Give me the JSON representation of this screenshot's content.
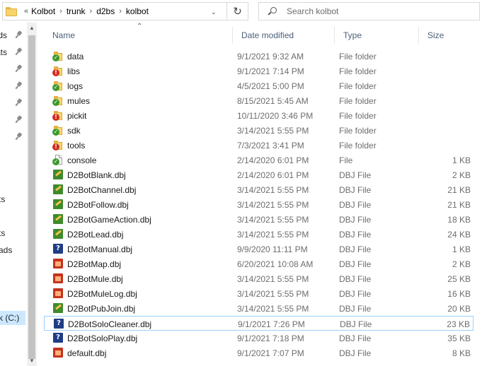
{
  "address": {
    "overflow": "«",
    "crumbs": [
      "Kolbot",
      "trunk",
      "d2bs",
      "kolbot"
    ]
  },
  "search": {
    "placeholder": "Search kolbot"
  },
  "nav": {
    "items": [
      {
        "label": "ds",
        "pinned": true
      },
      {
        "label": "ats",
        "pinned": true
      },
      {
        "label": "",
        "pinned": true
      },
      {
        "label": "",
        "pinned": true
      },
      {
        "label": "",
        "pinned": true
      },
      {
        "label": "",
        "pinned": true
      },
      {
        "label": "",
        "pinned": true
      },
      {
        "label": "ts",
        "pinned": false
      },
      {
        "label": "ts",
        "pinned": false
      },
      {
        "label": "ads",
        "pinned": false
      },
      {
        "label": "k (C:)",
        "pinned": false,
        "selected": true
      }
    ]
  },
  "columns": {
    "name": "Name",
    "date": "Date modified",
    "type": "Type",
    "size": "Size"
  },
  "files": [
    {
      "name": "data",
      "date": "9/1/2021 9:32 AM",
      "type": "File folder",
      "size": "",
      "icon": "folder-synced"
    },
    {
      "name": "libs",
      "date": "9/1/2021 7:14 PM",
      "type": "File folder",
      "size": "",
      "icon": "folder-conflict"
    },
    {
      "name": "logs",
      "date": "4/5/2021 5:00 PM",
      "type": "File folder",
      "size": "",
      "icon": "folder-synced"
    },
    {
      "name": "mules",
      "date": "8/15/2021 5:45 AM",
      "type": "File folder",
      "size": "",
      "icon": "folder-synced"
    },
    {
      "name": "pickit",
      "date": "10/11/2020 3:46 PM",
      "type": "File folder",
      "size": "",
      "icon": "folder-conflict"
    },
    {
      "name": "sdk",
      "date": "3/14/2021 5:55 PM",
      "type": "File folder",
      "size": "",
      "icon": "folder-synced"
    },
    {
      "name": "tools",
      "date": "7/3/2021 3:41 PM",
      "type": "File folder",
      "size": "",
      "icon": "folder-conflict"
    },
    {
      "name": "console",
      "date": "2/14/2020 6:01 PM",
      "type": "File",
      "size": "1 KB",
      "icon": "file-synced"
    },
    {
      "name": "D2BotBlank.dbj",
      "date": "2/14/2020 6:01 PM",
      "type": "DBJ File",
      "size": "2 KB",
      "icon": "dbj-green"
    },
    {
      "name": "D2BotChannel.dbj",
      "date": "3/14/2021 5:55 PM",
      "type": "DBJ File",
      "size": "21 KB",
      "icon": "dbj-green"
    },
    {
      "name": "D2BotFollow.dbj",
      "date": "3/14/2021 5:55 PM",
      "type": "DBJ File",
      "size": "21 KB",
      "icon": "dbj-green"
    },
    {
      "name": "D2BotGameAction.dbj",
      "date": "3/14/2021 5:55 PM",
      "type": "DBJ File",
      "size": "18 KB",
      "icon": "dbj-green"
    },
    {
      "name": "D2BotLead.dbj",
      "date": "3/14/2021 5:55 PM",
      "type": "DBJ File",
      "size": "24 KB",
      "icon": "dbj-green"
    },
    {
      "name": "D2BotManual.dbj",
      "date": "9/9/2020 11:11 PM",
      "type": "DBJ File",
      "size": "1 KB",
      "icon": "dbj-blue"
    },
    {
      "name": "D2BotMap.dbj",
      "date": "6/20/2021 10:08 AM",
      "type": "DBJ File",
      "size": "2 KB",
      "icon": "dbj-red"
    },
    {
      "name": "D2BotMule.dbj",
      "date": "3/14/2021 5:55 PM",
      "type": "DBJ File",
      "size": "25 KB",
      "icon": "dbj-red"
    },
    {
      "name": "D2BotMuleLog.dbj",
      "date": "3/14/2021 5:55 PM",
      "type": "DBJ File",
      "size": "16 KB",
      "icon": "dbj-red"
    },
    {
      "name": "D2BotPubJoin.dbj",
      "date": "3/14/2021 5:55 PM",
      "type": "DBJ File",
      "size": "20 KB",
      "icon": "dbj-green"
    },
    {
      "name": "D2BotSoloCleaner.dbj",
      "date": "9/1/2021 7:26 PM",
      "type": "DBJ File",
      "size": "23 KB",
      "icon": "dbj-blue",
      "focused": true
    },
    {
      "name": "D2BotSoloPlay.dbj",
      "date": "9/1/2021 7:18 PM",
      "type": "DBJ File",
      "size": "35 KB",
      "icon": "dbj-blue"
    },
    {
      "name": "default.dbj",
      "date": "9/1/2021 7:07 PM",
      "type": "DBJ File",
      "size": "8 KB",
      "icon": "dbj-red"
    }
  ]
}
